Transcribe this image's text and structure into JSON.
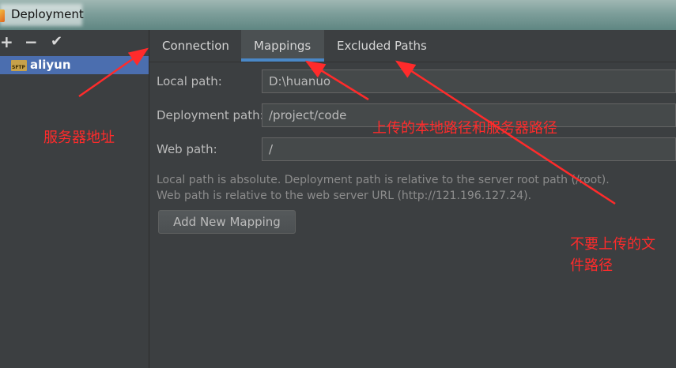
{
  "window": {
    "title": "Deployment"
  },
  "toolbar": {
    "add": "+",
    "remove": "−",
    "apply": "✔"
  },
  "servers": [
    {
      "label": "aliyun",
      "type": "SFTP"
    }
  ],
  "tabs": [
    {
      "label": "Connection",
      "active": false
    },
    {
      "label": "Mappings",
      "active": true
    },
    {
      "label": "Excluded Paths",
      "active": false
    }
  ],
  "mapping": {
    "local_label": "Local path:",
    "local_value": "D:\\huanuo",
    "deploy_label": "Deployment path:",
    "deploy_value": "/project/code",
    "web_label": "Web path:",
    "web_value": "/",
    "hint_line1": "Local path is absolute. Deployment path is relative to the server root path (/root).",
    "hint_line2": "Web path is relative to the web server URL (http://121.196.127.24).",
    "add_button": "Add New Mapping"
  },
  "annotations": {
    "server_address": "服务器地址",
    "paths": "上传的本地路径和服务器路径",
    "excluded_line1": "不要上传的文",
    "excluded_line2": "件路径"
  },
  "colors": {
    "accent": "#4a88c7",
    "selection": "#4b6eaf",
    "annotation": "#ff2b2b"
  }
}
